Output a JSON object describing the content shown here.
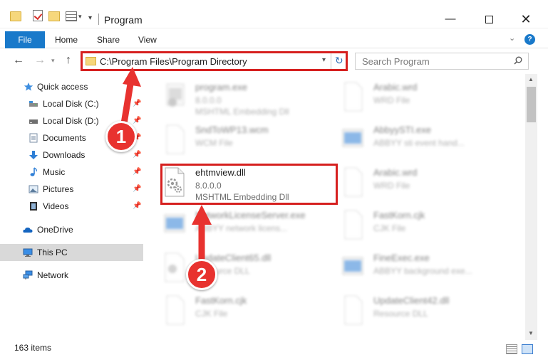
{
  "window": {
    "title": "Program",
    "minimize_glyph": "—",
    "close_glyph": "✕"
  },
  "ribbon": {
    "file": "File",
    "home": "Home",
    "share": "Share",
    "view": "View",
    "help": "?"
  },
  "nav": {
    "address": "C:\\Program Files\\Program Directory",
    "search_placeholder": "Search Program"
  },
  "sidebar": {
    "items": [
      {
        "label": "Quick access",
        "icon": "star-icon"
      },
      {
        "label": "Local Disk (C:)",
        "icon": "drive-icon",
        "pinned": true
      },
      {
        "label": "Local Disk (D:)",
        "icon": "drive-icon",
        "pinned": true
      },
      {
        "label": "Documents",
        "icon": "documents-icon",
        "pinned": true
      },
      {
        "label": "Downloads",
        "icon": "download-icon",
        "pinned": true
      },
      {
        "label": "Music",
        "icon": "music-icon",
        "pinned": true
      },
      {
        "label": "Pictures",
        "icon": "pictures-icon",
        "pinned": true
      },
      {
        "label": "Videos",
        "icon": "videos-icon",
        "pinned": true
      },
      {
        "label": "OneDrive",
        "icon": "cloud-icon"
      },
      {
        "label": "This PC",
        "icon": "computer-icon",
        "selected": true
      },
      {
        "label": "Network",
        "icon": "network-icon"
      }
    ]
  },
  "files": {
    "left": [
      {
        "name": "program.exe",
        "line2": "8.0.0.0",
        "line3": "MSHTML Embedding Dll",
        "kind": "exe"
      },
      {
        "name": "SndToWP13.wcm",
        "line2": "WCM File",
        "line3": "",
        "kind": "doc"
      },
      {
        "name": "ehtmview.dll",
        "line2": "8.0.0.0",
        "line3": "MSHTML Embedding Dll",
        "kind": "dll"
      },
      {
        "name": "NetworkLicenseServer.exe",
        "line2": "ABBYY network licens...",
        "line3": "",
        "kind": "exe-blue"
      },
      {
        "name": "UpdateClient65.dll",
        "line2": "Resource DLL",
        "line3": "",
        "kind": "dll"
      },
      {
        "name": "FastKorn.cjk",
        "line2": "CJK File",
        "line3": "",
        "kind": "doc"
      }
    ],
    "right": [
      {
        "name": "Arabic.wrd",
        "line2": "WRD File",
        "kind": "doc"
      },
      {
        "name": "AbbyySTI.exe",
        "line2": "ABBYY sti event hand...",
        "kind": "exe-blue"
      },
      {
        "name": "Arabic.wrd",
        "line2": "WRD File",
        "kind": "doc"
      },
      {
        "name": "FastKorn.cjk",
        "line2": "CJK File",
        "kind": "doc"
      },
      {
        "name": "FineExec.exe",
        "line2": "ABBYY background exe...",
        "kind": "exe-blue"
      },
      {
        "name": "UpdateClient42.dll",
        "line2": "Resource DLL",
        "kind": "dll"
      }
    ]
  },
  "status": {
    "items_count": "163 items"
  },
  "annotations": {
    "step1": "1",
    "step2": "2"
  },
  "colors": {
    "accent": "#1979ca",
    "annotation_red": "#d6201f"
  }
}
